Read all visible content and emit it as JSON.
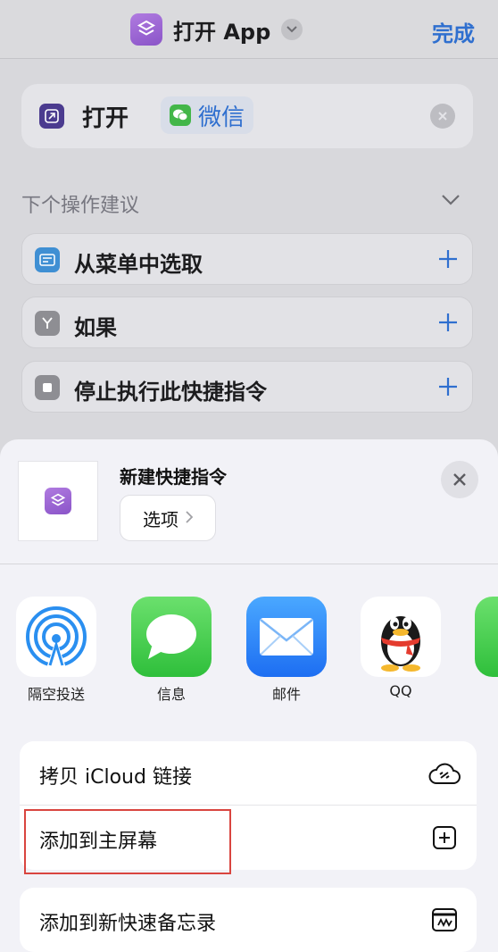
{
  "nav": {
    "title": "打开 App",
    "done_label": "完成"
  },
  "action": {
    "verb": "打开",
    "app_name": "微信"
  },
  "suggestions": {
    "header": "下个操作建议",
    "items": [
      {
        "label": "从菜单中选取",
        "icon": "menu-icon",
        "color": "#3f8fd3"
      },
      {
        "label": "如果",
        "icon": "branch-icon",
        "color": "#8e8e93"
      },
      {
        "label": "停止执行此快捷指令",
        "icon": "stop-icon",
        "color": "#8e8e93"
      }
    ]
  },
  "sheet": {
    "title": "新建快捷指令",
    "options_label": "选项",
    "share_targets": [
      {
        "label": "隔空投送",
        "icon": "airdrop-icon"
      },
      {
        "label": "信息",
        "icon": "messages-icon"
      },
      {
        "label": "邮件",
        "icon": "mail-icon"
      },
      {
        "label": "QQ",
        "icon": "qq-icon"
      }
    ],
    "actions": [
      {
        "label": "拷贝 iCloud 链接",
        "icon": "cloud-link-icon"
      },
      {
        "label": "添加到主屏幕",
        "icon": "add-square-icon"
      },
      {
        "label": "添加到新快速备忘录",
        "icon": "quick-note-icon"
      }
    ]
  },
  "colors": {
    "accent": "#2f6fcf",
    "highlight": "#d9453f"
  }
}
